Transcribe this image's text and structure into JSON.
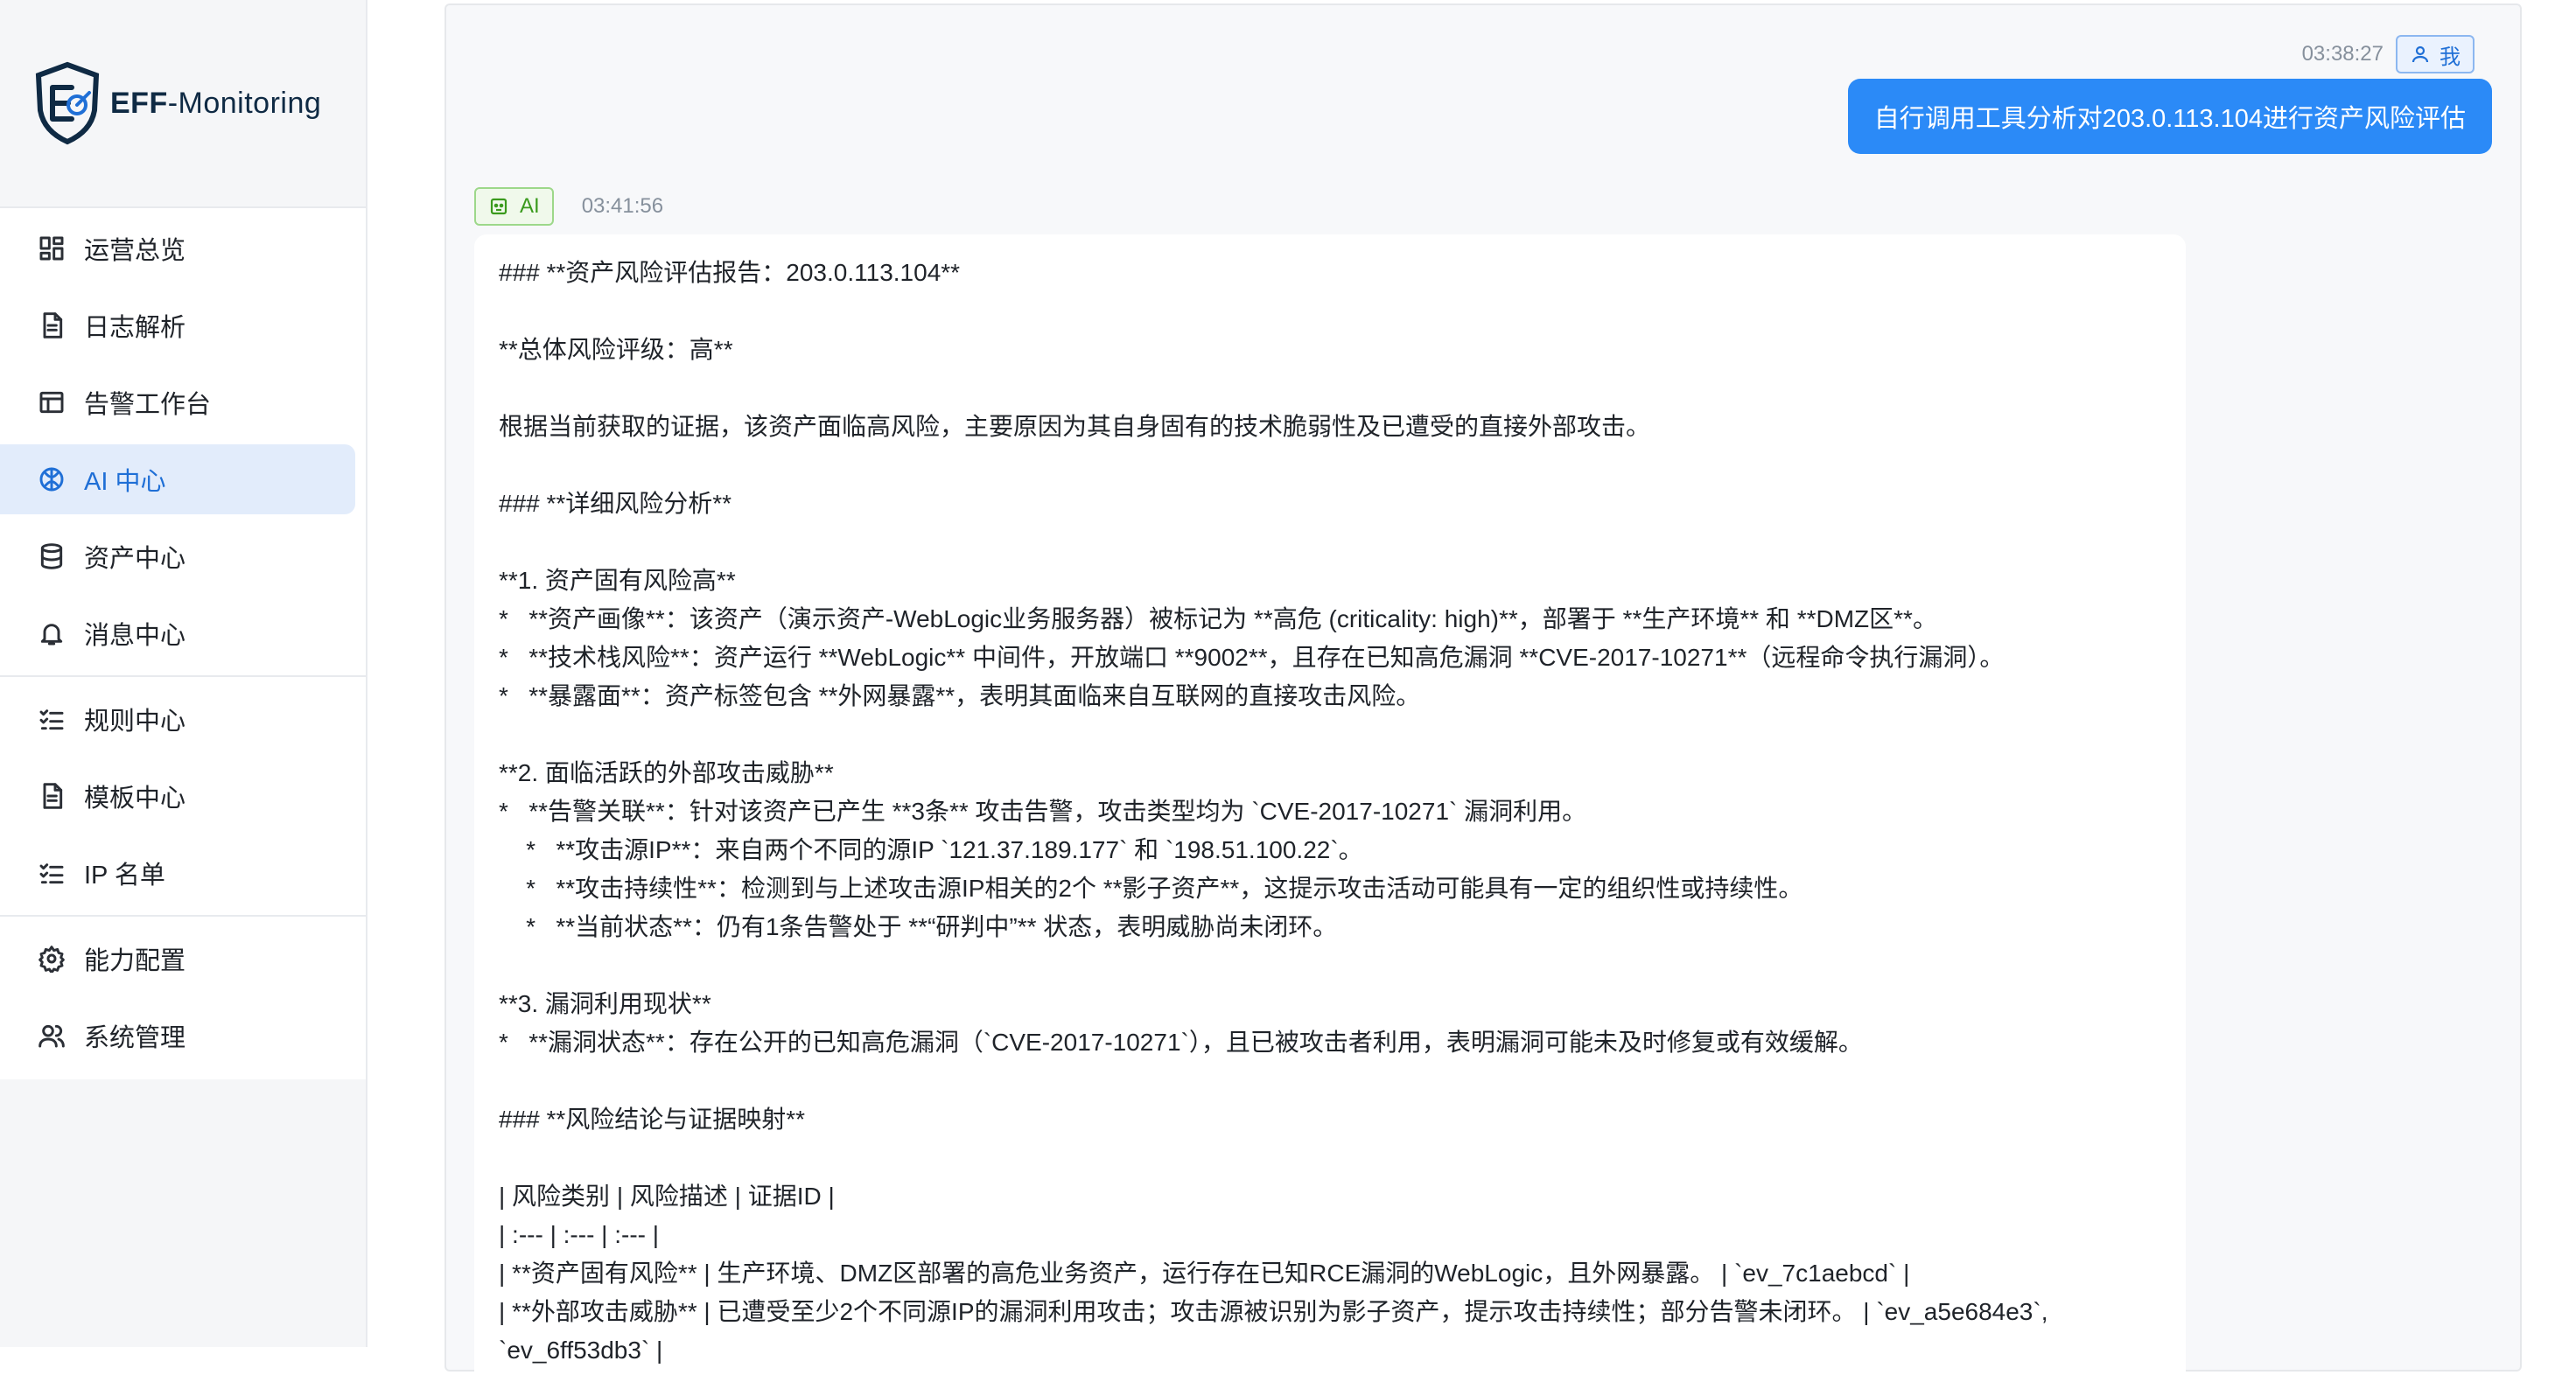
{
  "brand": {
    "name_bold": "EFF",
    "name_rest": "-Monitoring"
  },
  "nav": [
    {
      "label": "运营总览",
      "icon": "dashboard-icon"
    },
    {
      "label": "日志解析",
      "icon": "document-icon"
    },
    {
      "label": "告警工作台",
      "icon": "table-icon"
    },
    {
      "label": "AI 中心",
      "icon": "brain-icon",
      "active": true
    },
    {
      "label": "资产中心",
      "icon": "database-icon"
    },
    {
      "label": "消息中心",
      "icon": "bell-icon"
    },
    {
      "label": "规则中心",
      "icon": "checklist-icon"
    },
    {
      "label": "模板中心",
      "icon": "document-icon"
    },
    {
      "label": "IP 名单",
      "icon": "checklist-icon"
    },
    {
      "label": "能力配置",
      "icon": "gear-icon"
    },
    {
      "label": "系统管理",
      "icon": "users-icon"
    }
  ],
  "chat": {
    "user": {
      "time": "03:38:27",
      "badge": "我",
      "message": "自行调用工具分析对203.0.113.104进行资产风险评估"
    },
    "ai": {
      "badge": "AI",
      "time": "03:41:56",
      "lines": [
        "### **资产风险评估报告：203.0.113.104**",
        "",
        "**总体风险评级：高**",
        "",
        "根据当前获取的证据，该资产面临高风险，主要原因为其自身固有的技术脆弱性及已遭受的直接外部攻击。",
        "",
        "### **详细风险分析**",
        "",
        "**1. 资产固有风险高**",
        "*   **资产画像**：该资产（演示资产-WebLogic业务服务器）被标记为 **高危 (criticality: high)**，部署于 **生产环境** 和 **DMZ区**。",
        "*   **技术栈风险**：资产运行 **WebLogic** 中间件，开放端口 **9002**，且存在已知高危漏洞 **CVE-2017-10271**（远程命令执行漏洞）。",
        "*   **暴露面**：资产标签包含 **外网暴露**，表明其面临来自互联网的直接攻击风险。",
        "",
        "**2. 面临活跃的外部攻击威胁**",
        "*   **告警关联**：针对该资产已产生 **3条** 攻击告警，攻击类型均为 `CVE-2017-10271` 漏洞利用。",
        "    *   **攻击源IP**：来自两个不同的源IP `121.37.189.177` 和 `198.51.100.22`。",
        "    *   **攻击持续性**：检测到与上述攻击源IP相关的2个 **影子资产**，这提示攻击活动可能具有一定的组织性或持续性。",
        "    *   **当前状态**：仍有1条告警处于 **“研判中”** 状态，表明威胁尚未闭环。",
        "",
        "**3. 漏洞利用现状**",
        "*   **漏洞状态**：存在公开的已知高危漏洞（`CVE-2017-10271`），且已被攻击者利用，表明漏洞可能未及时修复或有效缓解。",
        "",
        "### **风险结论与证据映射**",
        "",
        "| 风险类别 | 风险描述 | 证据ID |",
        "| :--- | :--- | :--- |",
        "| **资产固有风险** | 生产环境、DMZ区部署的高危业务资产，运行存在已知RCE漏洞的WebLogic，且外网暴露。 | `ev_7c1aebcd` |",
        "| **外部攻击威胁** | 已遭受至少2个不同源IP的漏洞利用攻击；攻击源被识别为影子资产，提示攻击持续性；部分告警未闭环。 | `ev_a5e684e3`,",
        "`ev_6ff53db3` |"
      ]
    }
  }
}
